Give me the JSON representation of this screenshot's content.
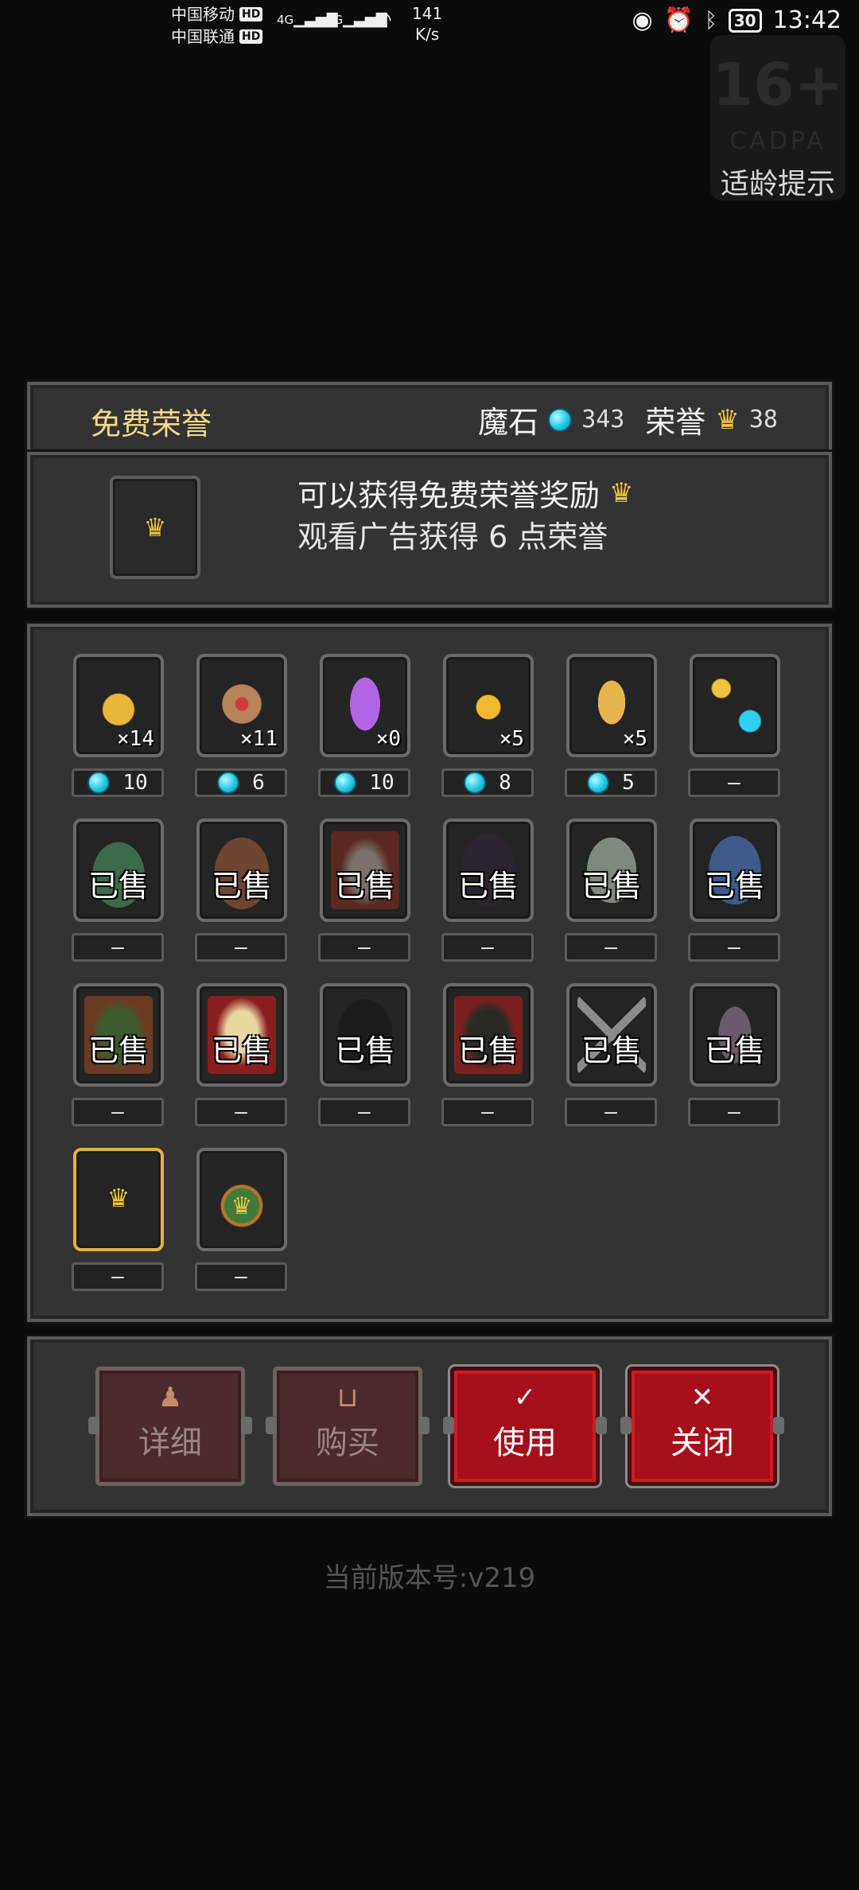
{
  "status_bar": {
    "carrier1": "中国移动",
    "carrier2": "中国联通",
    "hd": "HD",
    "signal_tag": "4G",
    "speed_value": "141",
    "speed_unit": "K/s",
    "battery": "30",
    "time": "13:42",
    "icons": [
      "signal-icon",
      "wifi-icon",
      "eye-icon",
      "alarm-icon",
      "bluetooth-icon",
      "battery-icon"
    ]
  },
  "age_badge": {
    "rating": "16+",
    "org": "CADPA",
    "hint": "适龄提示"
  },
  "header": {
    "title": "免费荣誉",
    "currency1_label": "魔石",
    "currency1_value": "343",
    "currency2_label": "荣誉",
    "currency2_value": "38"
  },
  "info": {
    "line1": "可以获得免费荣誉奖励",
    "line2": "观看广告获得 6 点荣誉"
  },
  "items": [
    {
      "name": "gold-bars",
      "count": "×14",
      "price": "10",
      "gem": true,
      "sold": false,
      "icon": "gold-bars-icon"
    },
    {
      "name": "heart-scroll",
      "count": "×11",
      "price": "6",
      "gem": true,
      "sold": false,
      "icon": "scroll-icon"
    },
    {
      "name": "purple-crystal",
      "count": "×0",
      "price": "10",
      "gem": true,
      "sold": false,
      "icon": "crystal-icon"
    },
    {
      "name": "golden-apple",
      "count": "×5",
      "price": "8",
      "gem": true,
      "sold": false,
      "icon": "apple-icon"
    },
    {
      "name": "golden-bell",
      "count": "×5",
      "price": "5",
      "gem": true,
      "sold": false,
      "icon": "bell-icon"
    },
    {
      "name": "crown-to-gem",
      "count": "",
      "price": "—",
      "gem": false,
      "sold": false,
      "icon": "exchange-icon"
    },
    {
      "name": "slime-hero",
      "count": "",
      "price": "—",
      "gem": false,
      "sold": true,
      "sold_text": "已售",
      "icon": "character-icon"
    },
    {
      "name": "treant-hero",
      "count": "",
      "price": "—",
      "gem": false,
      "sold": true,
      "sold_text": "已售",
      "icon": "character-icon"
    },
    {
      "name": "knight-hero",
      "count": "",
      "price": "—",
      "gem": false,
      "sold": true,
      "sold_text": "已售",
      "icon": "character-icon"
    },
    {
      "name": "hooded-hero",
      "count": "",
      "price": "—",
      "gem": false,
      "sold": true,
      "sold_text": "已售",
      "icon": "character-icon"
    },
    {
      "name": "ghost-hero",
      "count": "",
      "price": "—",
      "gem": false,
      "sold": true,
      "sold_text": "已售",
      "icon": "character-icon"
    },
    {
      "name": "mage-hero",
      "count": "",
      "price": "—",
      "gem": false,
      "sold": true,
      "sold_text": "已售",
      "icon": "character-icon"
    },
    {
      "name": "forest-hero",
      "count": "",
      "price": "—",
      "gem": false,
      "sold": true,
      "sold_text": "已售",
      "icon": "character-icon"
    },
    {
      "name": "blonde-hero",
      "count": "",
      "price": "—",
      "gem": false,
      "sold": true,
      "sold_text": "已售",
      "icon": "character-icon"
    },
    {
      "name": "shadow-hero",
      "count": "",
      "price": "—",
      "gem": false,
      "sold": true,
      "sold_text": "已售",
      "icon": "character-icon"
    },
    {
      "name": "pirate-hero",
      "count": "",
      "price": "—",
      "gem": false,
      "sold": true,
      "sold_text": "已售",
      "icon": "character-icon"
    },
    {
      "name": "swords-item",
      "count": "",
      "price": "—",
      "gem": false,
      "sold": true,
      "sold_text": "已售",
      "icon": "swords-icon"
    },
    {
      "name": "hourglass-item",
      "count": "",
      "price": "—",
      "gem": false,
      "sold": true,
      "sold_text": "已售",
      "icon": "hourglass-icon"
    },
    {
      "name": "free-crown",
      "count": "",
      "price": "—",
      "gem": false,
      "sold": false,
      "selected": true,
      "icon": "crown-icon"
    },
    {
      "name": "crown-bag",
      "count": "",
      "price": "—",
      "gem": false,
      "sold": false,
      "icon": "bag-icon"
    }
  ],
  "buttons": [
    {
      "label": "详细",
      "active": false,
      "icon": "potion-icon"
    },
    {
      "label": "购买",
      "active": false,
      "icon": "cart-icon"
    },
    {
      "label": "使用",
      "active": true,
      "icon": "check-icon"
    },
    {
      "label": "关闭",
      "active": true,
      "icon": "close-icon"
    }
  ],
  "footer": {
    "version": "当前版本号:v219"
  },
  "colors": {
    "accent_gold": "#f2c33c",
    "gem_cyan": "#22c8e6",
    "button_red": "#a5101a",
    "panel_bg": "#333333"
  }
}
